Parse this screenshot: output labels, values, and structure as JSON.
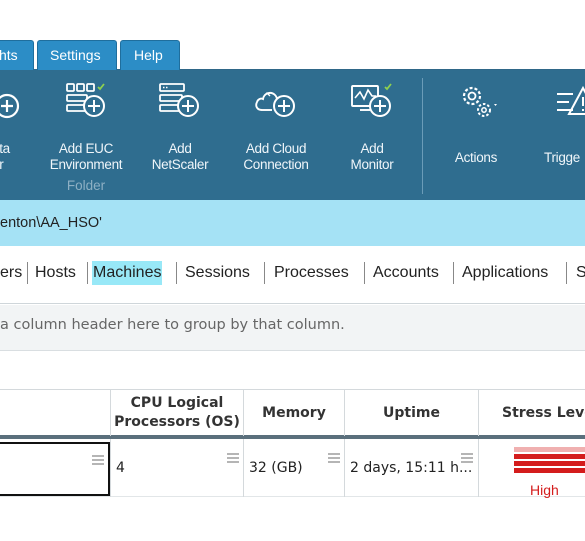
{
  "tabs": [
    {
      "label": "hts"
    },
    {
      "label": "Settings"
    },
    {
      "label": "Help"
    }
  ],
  "ribbon": {
    "buttons": [
      {
        "line1": "ata",
        "line2": "or"
      },
      {
        "line1": "Add EUC",
        "line2": "Environment"
      },
      {
        "line1": "Add",
        "line2": "NetScaler"
      },
      {
        "line1": "Add Cloud",
        "line2": "Connection"
      },
      {
        "line1": "Add",
        "line2": "Monitor"
      },
      {
        "line1": "Actions",
        "line2": ""
      },
      {
        "line1": "Trigge",
        "line2": ""
      }
    ],
    "group_label": "Folder"
  },
  "path": "enton\\AA_HSO'",
  "nav": [
    {
      "label": "ers"
    },
    {
      "label": "Hosts"
    },
    {
      "label": "Machines"
    },
    {
      "label": "Sessions"
    },
    {
      "label": "Processes"
    },
    {
      "label": "Accounts"
    },
    {
      "label": "Applications"
    },
    {
      "label": "S"
    }
  ],
  "group_hint": "a column header here to group by that column.",
  "grid": {
    "columns": [
      {
        "label": ""
      },
      {
        "label": "CPU Logical Processors (OS)",
        "l1": "CPU Logical",
        "l2": "Processors (OS)"
      },
      {
        "label": "Memory"
      },
      {
        "label": "Uptime"
      },
      {
        "label": "Stress Leve"
      }
    ],
    "row": {
      "cpu": "4",
      "memory": "32 (GB)",
      "uptime": "2 days, 15:11 h...",
      "stress": "High",
      "stress_color": "#d41c1c"
    }
  },
  "colors": {
    "ribbon_bg": "#2f6d8f",
    "tab_bg": "#2c8dc6",
    "path_bg": "#a5e2f5",
    "active_nav_bg": "#98e8f7"
  },
  "icons": [
    "plus-circle-icon",
    "euc-environment-icon",
    "netscaler-icon",
    "cloud-connection-icon",
    "monitor-icon",
    "gears-icon",
    "trigger-icon",
    "column-filter-icon"
  ]
}
